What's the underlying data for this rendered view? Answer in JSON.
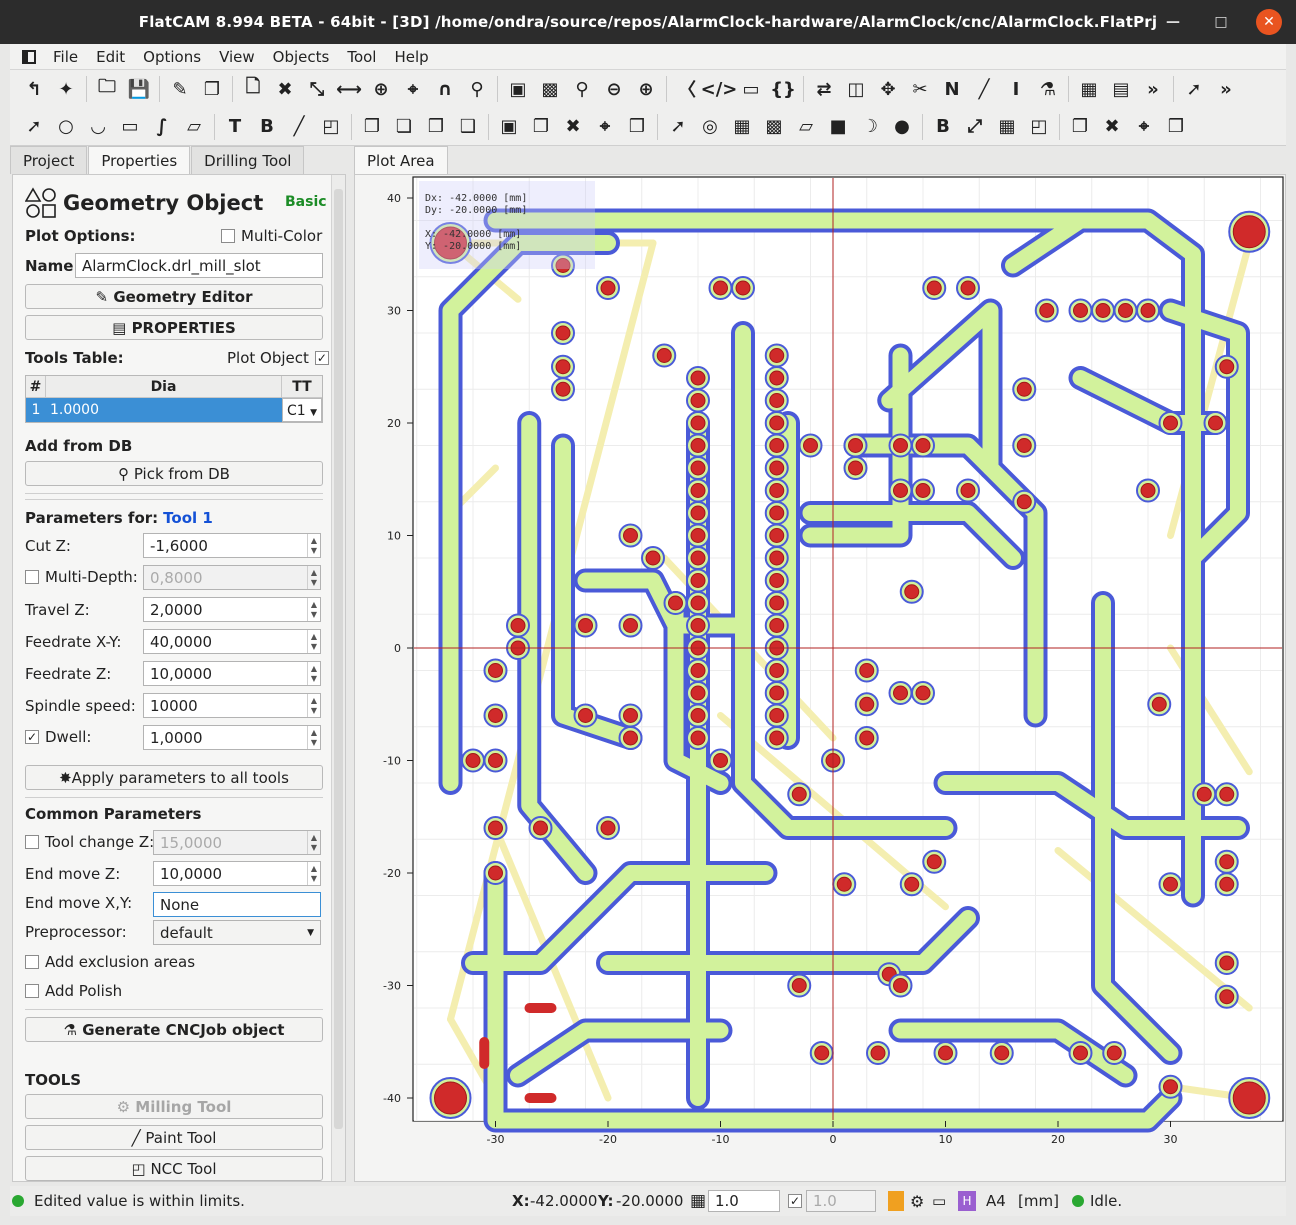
{
  "window": {
    "title": "FlatCAM 8.994 BETA - 64bit - [3D]   /home/ondra/source/repos/AlarmClock-hardware/AlarmClock/cnc/AlarmClock.FlatPrj"
  },
  "menu": [
    "File",
    "Edit",
    "Options",
    "View",
    "Objects",
    "Tool",
    "Help"
  ],
  "tabs": {
    "project": "Project",
    "properties": "Properties",
    "drilling": "Drilling Tool",
    "plot": "Plot Area"
  },
  "panel": {
    "heading": "Geometry Object",
    "mode": "Basic",
    "plot_options": "Plot Options:",
    "multi_color": "Multi-Color",
    "name_label": "Name:",
    "name_value": "AlarmClock.drl_mill_slot",
    "geometry_editor": "Geometry Editor",
    "properties": "PROPERTIES",
    "tools_table": "Tools Table:",
    "plot_object": "Plot Object",
    "col_num": "#",
    "col_dia": "Dia",
    "col_tt": "TT",
    "row_num": "1",
    "row_dia": "1.0000",
    "row_tt": "C1",
    "add_from_db": "Add from DB",
    "pick_from_db": "Pick from DB",
    "params_for": "Parameters for:",
    "tool_name": "Tool 1",
    "cut_z_label": "Cut Z:",
    "cut_z": "-1,6000",
    "multi_depth_label": "Multi-Depth:",
    "multi_depth": "0,8000",
    "travel_z_label": "Travel Z:",
    "travel_z": "2,0000",
    "feed_xy_label": "Feedrate X-Y:",
    "feed_xy": "40,0000",
    "feed_z_label": "Feedrate Z:",
    "feed_z": "10,0000",
    "spindle_label": "Spindle speed:",
    "spindle": "10000",
    "dwell_label": "Dwell:",
    "dwell": "1,0000",
    "apply_all": "Apply parameters to all tools",
    "common": "Common Parameters",
    "toolchange_label": "Tool change Z:",
    "toolchange": "15,0000",
    "end_z_label": "End move Z:",
    "end_z": "10,0000",
    "end_xy_label": "End move X,Y:",
    "end_xy": "None",
    "preproc_label": "Preprocessor:",
    "preproc": "default",
    "exclusion": "Add exclusion areas",
    "polish": "Add Polish",
    "generate": "Generate CNCJob object",
    "tools": "TOOLS",
    "milling": "Milling Tool",
    "paint": "Paint Tool",
    "ncc": "NCC Tool"
  },
  "plot": {
    "info": {
      "dx": "Dx:    -42.0000 [mm]",
      "dy": "Dy:    -20.0000 [mm]",
      "x": "X:    -42.0000 [mm]",
      "y": "Y:    -20.0000 [mm]"
    },
    "x_ticks": [
      "-30",
      "-20",
      "-10",
      "0",
      "10",
      "20",
      "30"
    ],
    "y_ticks": [
      "40",
      "30",
      "20",
      "10",
      "0",
      "-10",
      "-20",
      "-30",
      "-40"
    ],
    "colors": {
      "trace_fill": "#d2f29c",
      "trace_outline": "#4a5ad8",
      "pad": "#d02a2a",
      "ratsnest": "#f4eeb0",
      "axis": "#b22222"
    }
  },
  "status": {
    "message": "Edited value is within limits.",
    "x_label": "X:",
    "x": "-42.0000",
    "y_label": "Y:",
    "y": "-20.0000",
    "grid": "1.0",
    "grid2": "1.0",
    "paper": "A4",
    "units": "[mm]",
    "state": "Idle."
  }
}
